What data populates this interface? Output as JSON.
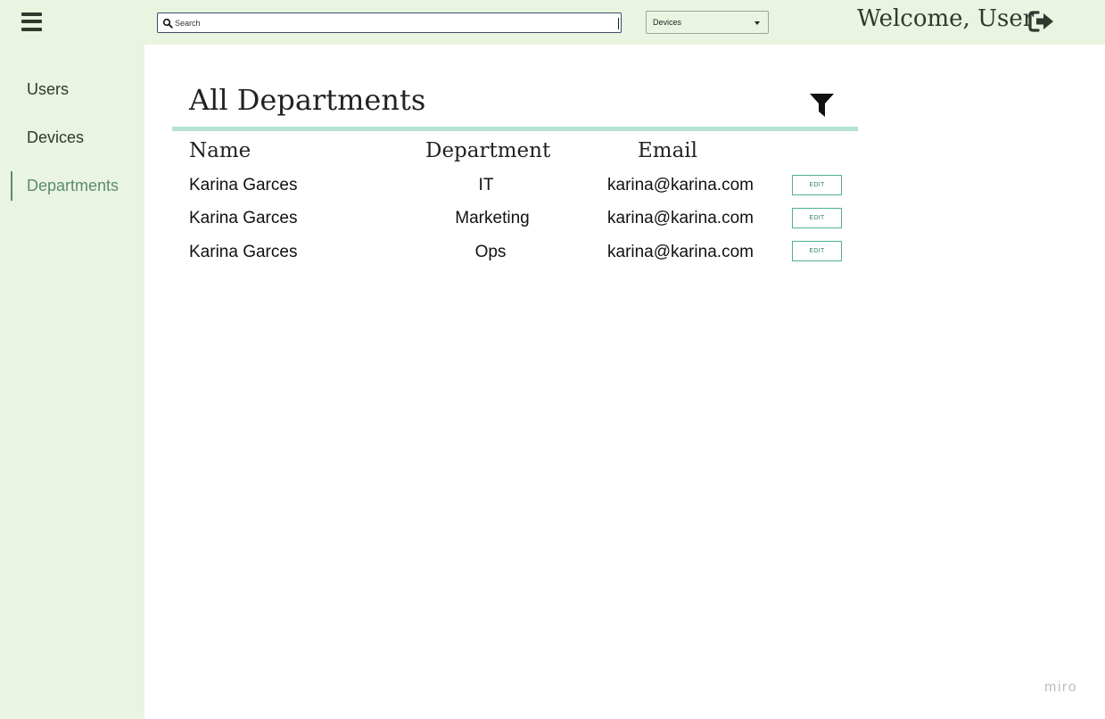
{
  "header": {
    "menu_icon": "hamburger-menu-icon",
    "search": {
      "placeholder": "Search",
      "value": "",
      "icon": "search-icon"
    },
    "select": {
      "selected": "Devices",
      "icon": "caret-down-icon"
    },
    "welcome": "Welcome, User",
    "logout_icon": "sign-out-icon"
  },
  "sidebar": {
    "items": [
      {
        "label": "Users",
        "active": false
      },
      {
        "label": "Devices",
        "active": false
      },
      {
        "label": "Departments",
        "active": true
      }
    ]
  },
  "main": {
    "title": "All Departments",
    "filter_icon": "filter-icon",
    "table": {
      "columns": [
        "Name",
        "Department",
        "Email"
      ],
      "rows": [
        {
          "name": "Karina Garces",
          "department": "IT",
          "email": "karina@karina.com",
          "action": "EDIT"
        },
        {
          "name": "Karina Garces",
          "department": "Marketing",
          "email": "karina@karina.com",
          "action": "EDIT"
        },
        {
          "name": "Karina Garces",
          "department": "Ops",
          "email": "karina@karina.com",
          "action": "EDIT"
        }
      ]
    }
  },
  "watermark": "miro",
  "colors": {
    "panel_background": "#e9f5e0",
    "accent": "#5d8a6f",
    "rule": "#b6e0d6",
    "edit_border": "#4fae97"
  }
}
